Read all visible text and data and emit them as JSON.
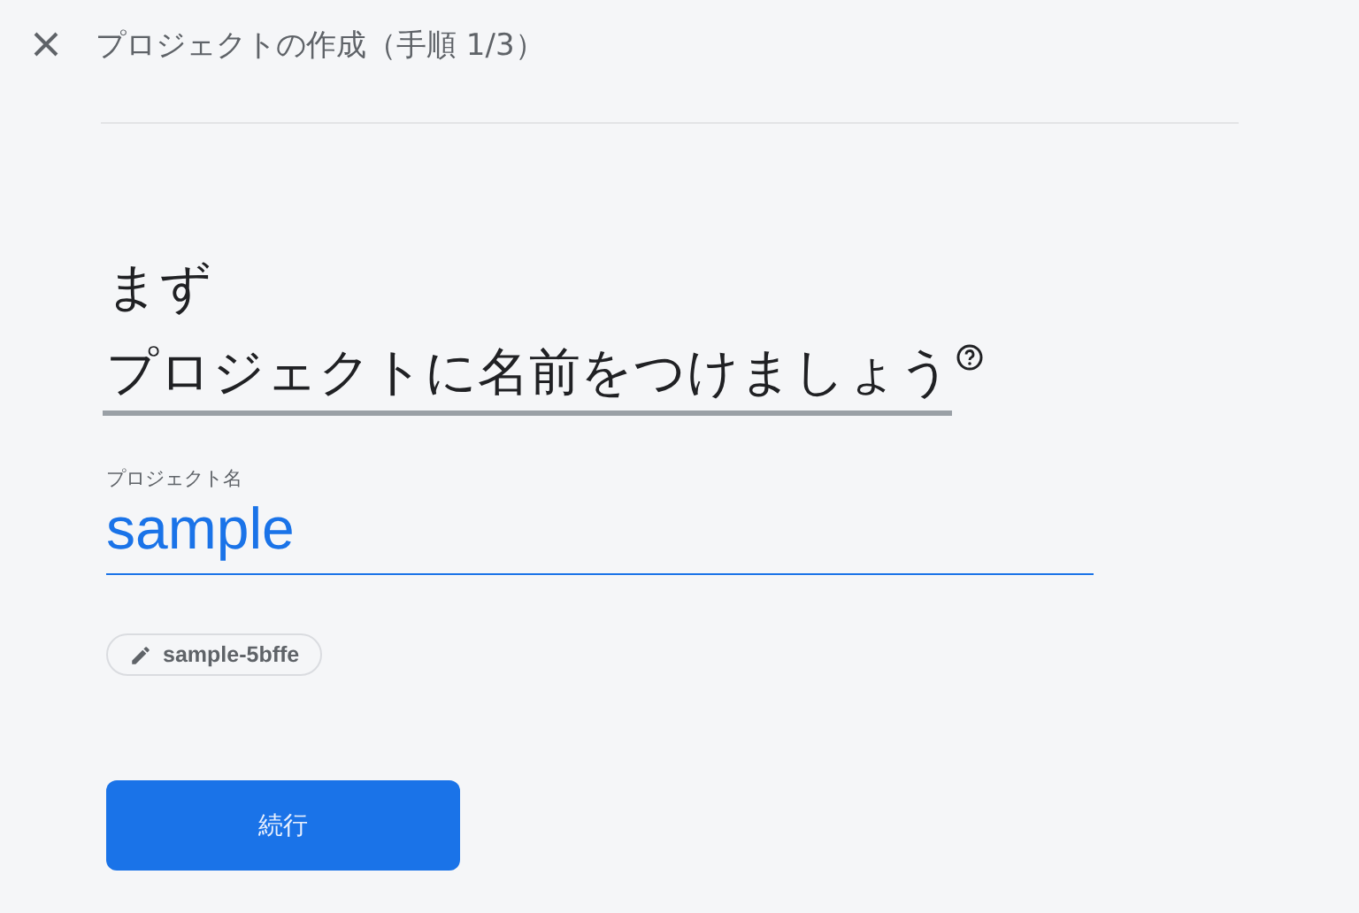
{
  "header": {
    "title": "プロジェクトの作成（手順 1/3）"
  },
  "heading": {
    "line_1": "まず",
    "line_2": "プロジェクトに名前をつけましょう"
  },
  "project_name_field": {
    "label": "プロジェクト名",
    "value": "sample"
  },
  "project_id_chip": {
    "text": "sample-5bffe"
  },
  "continue_button": {
    "label": "続行"
  }
}
